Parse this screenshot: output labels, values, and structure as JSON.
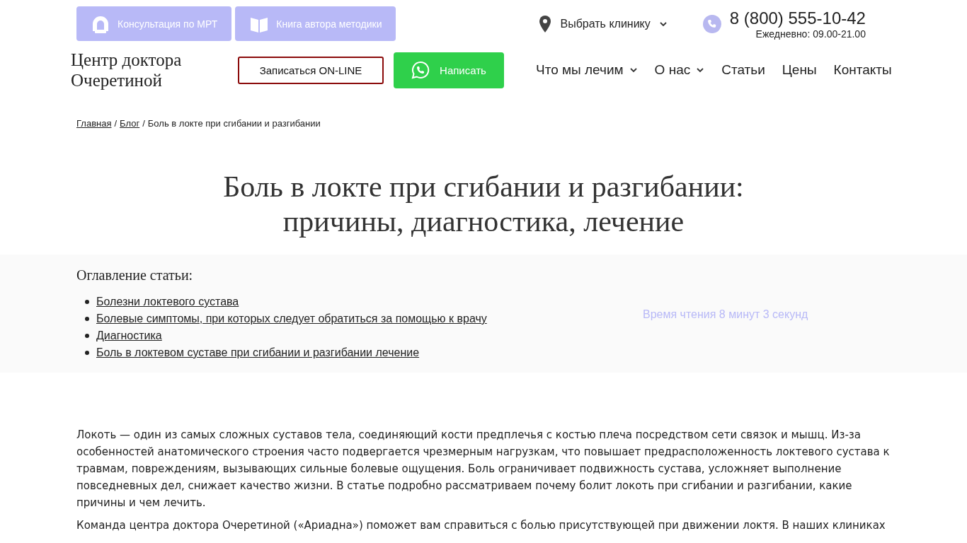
{
  "top_buttons": [
    {
      "kind": "mri",
      "label": "Консультация по МРТ"
    },
    {
      "kind": "book",
      "label": "Книга автора методики"
    }
  ],
  "clinic_select": {
    "label": "Выбрать клинику"
  },
  "phone": {
    "number": "8 (800) 555-10-42",
    "hours": "Ежедневно: 09.00-21.00"
  },
  "logo": {
    "line1": "Центр доктора",
    "line2": "Очеретиной"
  },
  "signup_button": "Записаться ON-LINE",
  "write_button": "Написать",
  "nav": [
    {
      "label": "Что мы лечим",
      "dropdown": true
    },
    {
      "label": "О нас",
      "dropdown": true
    },
    {
      "label": "Статьи",
      "dropdown": false
    },
    {
      "label": "Цены",
      "dropdown": false
    },
    {
      "label": "Контакты",
      "dropdown": false
    }
  ],
  "breadcrumb_separator": "/",
  "breadcrumbs": [
    {
      "label": "Главная",
      "link": true
    },
    {
      "label": "Блог",
      "link": true
    },
    {
      "label": "Боль в локте при сгибании и разгибании",
      "link": false
    }
  ],
  "title": {
    "line1": "Боль в локте при сгибании и разгибании:",
    "line2": "причины, диагностика, лечение"
  },
  "toc": {
    "heading": "Оглавление статьи:",
    "items": [
      "Болезни локтевого сустава",
      "Болевые симптомы, при которых следует обратиться за помощью к врачу",
      "Диагностика",
      "Боль в локтевом суставе при сгибании и разгибании лечение"
    ],
    "reading_time": "Время чтения 8 минут 3 секунд"
  },
  "paragraphs": [
    "Локоть — один из самых сложных суставов тела, соединяющий кости предплечья с костью плеча посредством сети связок и мышц. Из-за особенностей анатомического строения часто подвергается чрезмерным нагрузкам, что повышает предрасположенность локтевого сустава к травмам, повреждениям, вызывающих сильные болевые ощущения. Боль ограничивает подвижность сустава, усложняет выполнение повседневных дел, снижает качество жизни. В статье подробно рассматриваем почему болит локоть при сгибании и разгибании, какие причины и чем лечить.",
    "Команда центра доктора Очеретиной («Ариадна») поможет вам справиться с болью присутствующей при движении локтя. В наших клиниках"
  ]
}
